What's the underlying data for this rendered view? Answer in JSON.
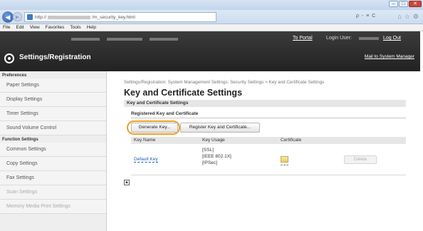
{
  "browser": {
    "url_prefix": "http://",
    "url_suffix": "/m_security_key.html",
    "search_hint": "ρ - ≡ C",
    "window_buttons": [
      "–",
      "□",
      "✕"
    ]
  },
  "menu": [
    "File",
    "Edit",
    "View",
    "Favorites",
    "Tools",
    "Help"
  ],
  "header": {
    "to_portal": "To Portal",
    "login_user_label": "Login User:",
    "logout": "Log Out",
    "app_title": "Settings/Registration",
    "mail_to_admin": "Mail to System Manager"
  },
  "sidebar": {
    "preferences_label": "Preferences",
    "preferences_items": [
      "Paper Settings",
      "Display Settings",
      "Timer Settings",
      "Sound Volume Control"
    ],
    "function_label": "Function Settings",
    "function_items": [
      "Common Settings",
      "Copy Settings",
      "Fax Settings",
      "Scan Settings",
      "Memory Media Print Settings"
    ]
  },
  "main": {
    "breadcrumb": "Settings/Registration: System Management Settings: Security Settings > Key and Certificate Settings",
    "title": "Key and Certificate Settings",
    "section": "Key and Certificate Settings",
    "subsection": "Registered Key and Certificate",
    "buttons": {
      "generate": "Generate Key...",
      "register": "Register Key and Certificate..."
    },
    "table": {
      "headers": [
        "Key Name",
        "Key Usage",
        "Certificate"
      ],
      "rows": [
        {
          "key_name": "Default Key",
          "usage": [
            "[SSL]",
            "[IEEE 802.1X]",
            "[IPSec]"
          ],
          "delete": "Delete"
        }
      ]
    }
  },
  "colors": {
    "header_bg": "#2b2b2b",
    "highlight": "#f0a020",
    "link": "#1a5fb4"
  }
}
